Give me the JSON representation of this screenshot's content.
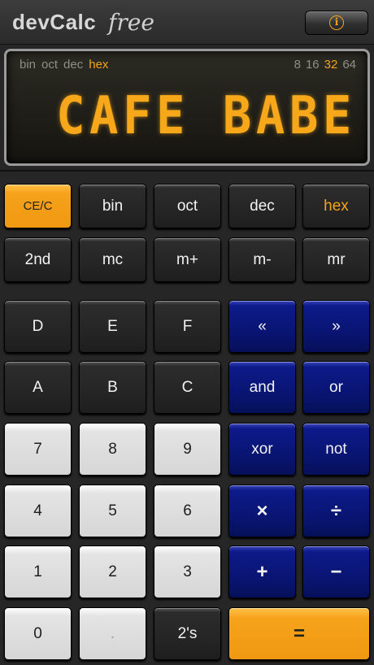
{
  "header": {
    "brand": "devCalc",
    "edition": "free",
    "info_icon": "info-icon",
    "info_glyph": "i"
  },
  "display": {
    "bases": [
      {
        "label": "bin",
        "active": false
      },
      {
        "label": "oct",
        "active": false
      },
      {
        "label": "dec",
        "active": false
      },
      {
        "label": "hex",
        "active": true
      }
    ],
    "widths": [
      {
        "label": "8",
        "active": false
      },
      {
        "label": "16",
        "active": false
      },
      {
        "label": "32",
        "active": true
      },
      {
        "label": "64",
        "active": false
      }
    ],
    "value": "CAFE BABE"
  },
  "colors": {
    "accent": "#f6a21b",
    "blue_key": "#0d1a8a",
    "dark_key": "#252525",
    "light_key": "#d6d6d6"
  },
  "keys": {
    "ce": "CE/C",
    "bin": "bin",
    "oct": "oct",
    "dec": "dec",
    "hex": "hex",
    "second": "2nd",
    "mc": "mc",
    "mplus": "m+",
    "mminus": "m-",
    "mr": "mr",
    "d": "D",
    "e": "E",
    "f": "F",
    "shl": "«",
    "shr": "»",
    "a": "A",
    "b": "B",
    "c": "C",
    "and": "and",
    "or": "or",
    "n7": "7",
    "n8": "8",
    "n9": "9",
    "xor": "xor",
    "not": "not",
    "n4": "4",
    "n5": "5",
    "n6": "6",
    "mul": "×",
    "div": "÷",
    "n1": "1",
    "n2": "2",
    "n3": "3",
    "add": "+",
    "sub": "−",
    "n0": "0",
    "dot": ".",
    "twos": "2's",
    "eq": "="
  }
}
